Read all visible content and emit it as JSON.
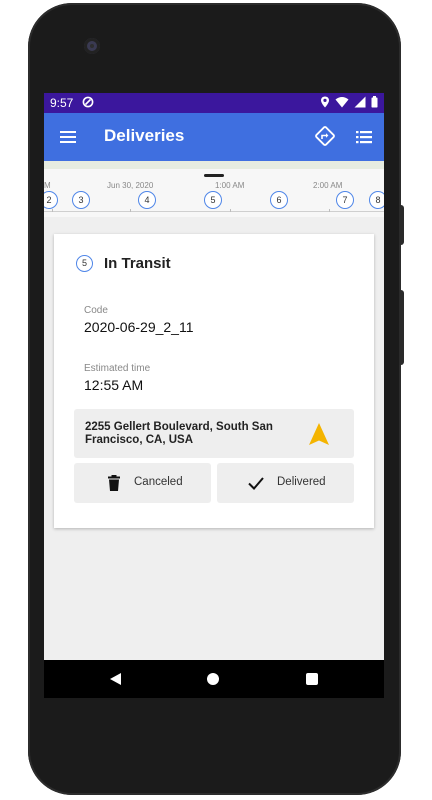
{
  "status_bar": {
    "time": "9:57"
  },
  "app_bar": {
    "title": "Deliveries"
  },
  "timeline": {
    "labels": [
      "M",
      "Jun 30, 2020",
      "1:00 AM",
      "2:00 AM"
    ],
    "stops": [
      "2",
      "3",
      "4",
      "5",
      "6",
      "7",
      "8"
    ]
  },
  "card": {
    "stop_number": "5",
    "status": "In Transit",
    "code_label": "Code",
    "code_value": "2020-06-29_2_11",
    "time_label": "Estimated time",
    "time_value": "12:55 AM",
    "address": "2255 Gellert Boulevard, South San Francisco, CA, USA",
    "canceled_label": "Canceled",
    "delivered_label": "Delivered"
  },
  "colors": {
    "status_bar": "#3b179d",
    "app_bar": "#3f6fe0",
    "stop_ring": "#4f86e8",
    "nav_arrow": "#f4b400"
  },
  "icons": {
    "menu": "menu-icon",
    "route": "route-icon",
    "list": "list-icon",
    "navigate": "navigation-arrow-icon",
    "canceled": "trash-icon",
    "delivered": "check-icon"
  }
}
